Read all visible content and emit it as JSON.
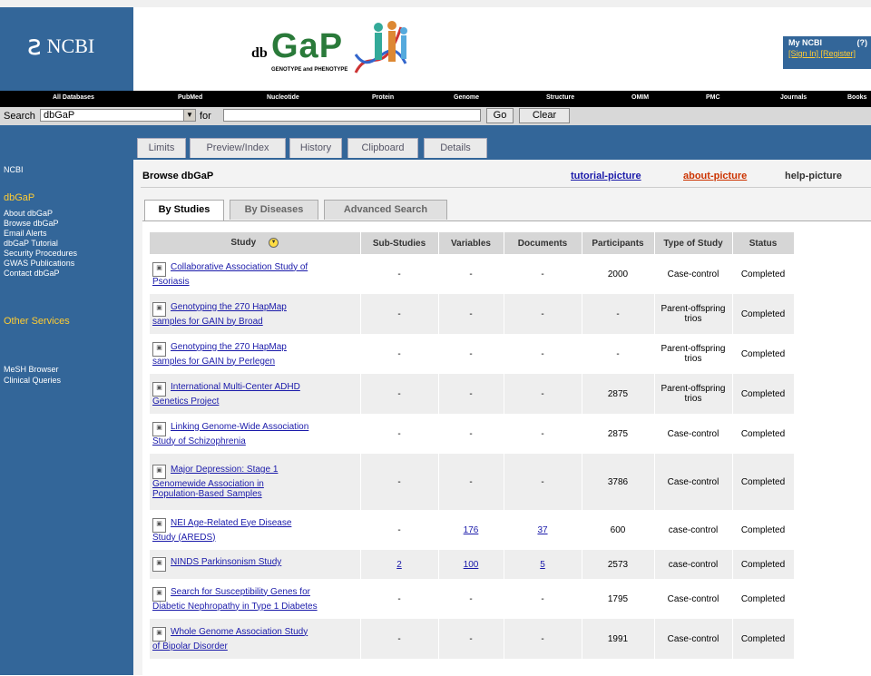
{
  "ncbi_logo": "NCBI",
  "dbgap_logo": {
    "db": "db",
    "gap": "GaP",
    "sub": "GENOTYPE and PHENOTYPE"
  },
  "my_ncbi": {
    "title": "My NCBI",
    "corner": "(?)",
    "links": "[Sign In] [Register]"
  },
  "nav": [
    "All Databases",
    "PubMed",
    "Nucleotide",
    "Protein",
    "Genome",
    "Structure",
    "OMIM",
    "PMC",
    "Journals",
    "Books"
  ],
  "search": {
    "label": "Search",
    "db_value": "dbGaP",
    "for_label": "for",
    "term_value": "",
    "go": "Go",
    "clear": "Clear"
  },
  "top_tabs": [
    "Limits",
    "Preview/Index",
    "History",
    "Clipboard",
    "Details"
  ],
  "sidebar": {
    "ncbi": "NCBI",
    "dbgap_heading": "dbGaP",
    "dbgap_items": [
      "About dbGaP",
      "Browse dbGaP",
      "Email Alerts",
      "dbGaP Tutorial",
      "Security Procedures",
      "GWAS Publications",
      "Contact dbGaP"
    ],
    "other_heading": "Other Services",
    "other_items": [
      "MeSH Browser",
      "Clinical Queries"
    ]
  },
  "main": {
    "title": "Browse dbGaP",
    "tutorial": "tutorial-picture",
    "about": "about-picture",
    "help": "help-picture",
    "tabs": [
      "By Studies",
      "By Diseases",
      "Advanced Search"
    ]
  },
  "table": {
    "headers": [
      "Study",
      "Sub-Studies",
      "Variables",
      "Documents",
      "Participants",
      "Type of Study",
      "Status"
    ],
    "rows": [
      {
        "study": [
          "Collaborative Association Study of",
          "Psoriasis"
        ],
        "sub": "-",
        "vars": "-",
        "docs": "-",
        "participants": "2000",
        "type": "Case-control",
        "status": "Completed"
      },
      {
        "study": [
          "Genotyping the 270 HapMap",
          "samples for GAIN by Broad"
        ],
        "sub": "-",
        "vars": "-",
        "docs": "-",
        "participants": "-",
        "type": "Parent-offspring trios",
        "status": "Completed"
      },
      {
        "study": [
          "Genotyping the 270 HapMap",
          "samples for GAIN by Perlegen"
        ],
        "sub": "-",
        "vars": "-",
        "docs": "-",
        "participants": "-",
        "type": "Parent-offspring trios",
        "status": "Completed"
      },
      {
        "study": [
          "International Multi-Center ADHD",
          "Genetics Project"
        ],
        "sub": "-",
        "vars": "-",
        "docs": "-",
        "participants": "2875",
        "type": "Parent-offspring trios",
        "status": "Completed"
      },
      {
        "study": [
          "Linking Genome-Wide Association",
          "Study of Schizophrenia"
        ],
        "sub": "-",
        "vars": "-",
        "docs": "-",
        "participants": "2875",
        "type": "Case-control",
        "status": "Completed"
      },
      {
        "study": [
          "Major Depression: Stage 1",
          "Genomewide Association in",
          "Population-Based Samples"
        ],
        "sub": "-",
        "vars": "-",
        "docs": "-",
        "participants": "3786",
        "type": "Case-control",
        "status": "Completed"
      },
      {
        "study": [
          "NEI Age-Related Eye Disease",
          "Study (AREDS)"
        ],
        "sub": "-",
        "vars": "176",
        "docs": "37",
        "participants": "600",
        "type": "case-control",
        "status": "Completed"
      },
      {
        "study": [
          "NINDS Parkinsonism Study"
        ],
        "sub": "2",
        "vars": "100",
        "docs": "5",
        "participants": "2573",
        "type": "case-control",
        "status": "Completed"
      },
      {
        "study": [
          "Search for Susceptibility Genes for",
          "Diabetic Nephropathy in Type 1 Diabetes"
        ],
        "sub": "-",
        "vars": "-",
        "docs": "-",
        "participants": "1795",
        "type": "Case-control",
        "status": "Completed"
      },
      {
        "study": [
          "Whole Genome Association Study",
          "of Bipolar Disorder"
        ],
        "sub": "-",
        "vars": "-",
        "docs": "-",
        "participants": "1991",
        "type": "Case-control",
        "status": "Completed"
      }
    ]
  }
}
